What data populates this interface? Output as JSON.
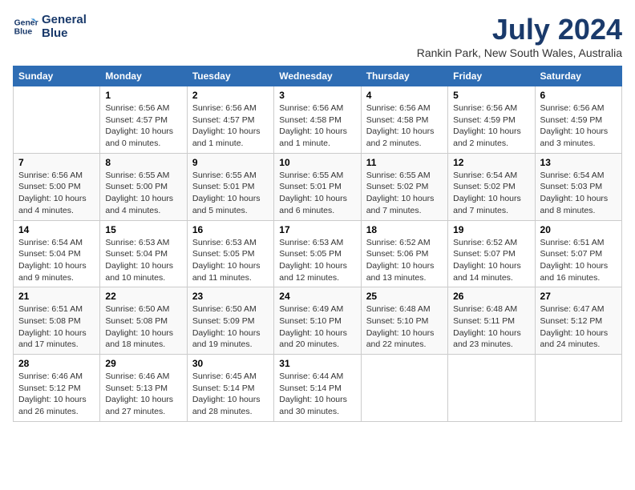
{
  "logo": {
    "line1": "General",
    "line2": "Blue"
  },
  "title": "July 2024",
  "location": "Rankin Park, New South Wales, Australia",
  "days_of_week": [
    "Sunday",
    "Monday",
    "Tuesday",
    "Wednesday",
    "Thursday",
    "Friday",
    "Saturday"
  ],
  "weeks": [
    [
      {
        "day": "",
        "info": ""
      },
      {
        "day": "1",
        "info": "Sunrise: 6:56 AM\nSunset: 4:57 PM\nDaylight: 10 hours\nand 0 minutes."
      },
      {
        "day": "2",
        "info": "Sunrise: 6:56 AM\nSunset: 4:57 PM\nDaylight: 10 hours\nand 1 minute."
      },
      {
        "day": "3",
        "info": "Sunrise: 6:56 AM\nSunset: 4:58 PM\nDaylight: 10 hours\nand 1 minute."
      },
      {
        "day": "4",
        "info": "Sunrise: 6:56 AM\nSunset: 4:58 PM\nDaylight: 10 hours\nand 2 minutes."
      },
      {
        "day": "5",
        "info": "Sunrise: 6:56 AM\nSunset: 4:59 PM\nDaylight: 10 hours\nand 2 minutes."
      },
      {
        "day": "6",
        "info": "Sunrise: 6:56 AM\nSunset: 4:59 PM\nDaylight: 10 hours\nand 3 minutes."
      }
    ],
    [
      {
        "day": "7",
        "info": "Sunrise: 6:56 AM\nSunset: 5:00 PM\nDaylight: 10 hours\nand 4 minutes."
      },
      {
        "day": "8",
        "info": "Sunrise: 6:55 AM\nSunset: 5:00 PM\nDaylight: 10 hours\nand 4 minutes."
      },
      {
        "day": "9",
        "info": "Sunrise: 6:55 AM\nSunset: 5:01 PM\nDaylight: 10 hours\nand 5 minutes."
      },
      {
        "day": "10",
        "info": "Sunrise: 6:55 AM\nSunset: 5:01 PM\nDaylight: 10 hours\nand 6 minutes."
      },
      {
        "day": "11",
        "info": "Sunrise: 6:55 AM\nSunset: 5:02 PM\nDaylight: 10 hours\nand 7 minutes."
      },
      {
        "day": "12",
        "info": "Sunrise: 6:54 AM\nSunset: 5:02 PM\nDaylight: 10 hours\nand 7 minutes."
      },
      {
        "day": "13",
        "info": "Sunrise: 6:54 AM\nSunset: 5:03 PM\nDaylight: 10 hours\nand 8 minutes."
      }
    ],
    [
      {
        "day": "14",
        "info": "Sunrise: 6:54 AM\nSunset: 5:04 PM\nDaylight: 10 hours\nand 9 minutes."
      },
      {
        "day": "15",
        "info": "Sunrise: 6:53 AM\nSunset: 5:04 PM\nDaylight: 10 hours\nand 10 minutes."
      },
      {
        "day": "16",
        "info": "Sunrise: 6:53 AM\nSunset: 5:05 PM\nDaylight: 10 hours\nand 11 minutes."
      },
      {
        "day": "17",
        "info": "Sunrise: 6:53 AM\nSunset: 5:05 PM\nDaylight: 10 hours\nand 12 minutes."
      },
      {
        "day": "18",
        "info": "Sunrise: 6:52 AM\nSunset: 5:06 PM\nDaylight: 10 hours\nand 13 minutes."
      },
      {
        "day": "19",
        "info": "Sunrise: 6:52 AM\nSunset: 5:07 PM\nDaylight: 10 hours\nand 14 minutes."
      },
      {
        "day": "20",
        "info": "Sunrise: 6:51 AM\nSunset: 5:07 PM\nDaylight: 10 hours\nand 16 minutes."
      }
    ],
    [
      {
        "day": "21",
        "info": "Sunrise: 6:51 AM\nSunset: 5:08 PM\nDaylight: 10 hours\nand 17 minutes."
      },
      {
        "day": "22",
        "info": "Sunrise: 6:50 AM\nSunset: 5:08 PM\nDaylight: 10 hours\nand 18 minutes."
      },
      {
        "day": "23",
        "info": "Sunrise: 6:50 AM\nSunset: 5:09 PM\nDaylight: 10 hours\nand 19 minutes."
      },
      {
        "day": "24",
        "info": "Sunrise: 6:49 AM\nSunset: 5:10 PM\nDaylight: 10 hours\nand 20 minutes."
      },
      {
        "day": "25",
        "info": "Sunrise: 6:48 AM\nSunset: 5:10 PM\nDaylight: 10 hours\nand 22 minutes."
      },
      {
        "day": "26",
        "info": "Sunrise: 6:48 AM\nSunset: 5:11 PM\nDaylight: 10 hours\nand 23 minutes."
      },
      {
        "day": "27",
        "info": "Sunrise: 6:47 AM\nSunset: 5:12 PM\nDaylight: 10 hours\nand 24 minutes."
      }
    ],
    [
      {
        "day": "28",
        "info": "Sunrise: 6:46 AM\nSunset: 5:12 PM\nDaylight: 10 hours\nand 26 minutes."
      },
      {
        "day": "29",
        "info": "Sunrise: 6:46 AM\nSunset: 5:13 PM\nDaylight: 10 hours\nand 27 minutes."
      },
      {
        "day": "30",
        "info": "Sunrise: 6:45 AM\nSunset: 5:14 PM\nDaylight: 10 hours\nand 28 minutes."
      },
      {
        "day": "31",
        "info": "Sunrise: 6:44 AM\nSunset: 5:14 PM\nDaylight: 10 hours\nand 30 minutes."
      },
      {
        "day": "",
        "info": ""
      },
      {
        "day": "",
        "info": ""
      },
      {
        "day": "",
        "info": ""
      }
    ]
  ]
}
